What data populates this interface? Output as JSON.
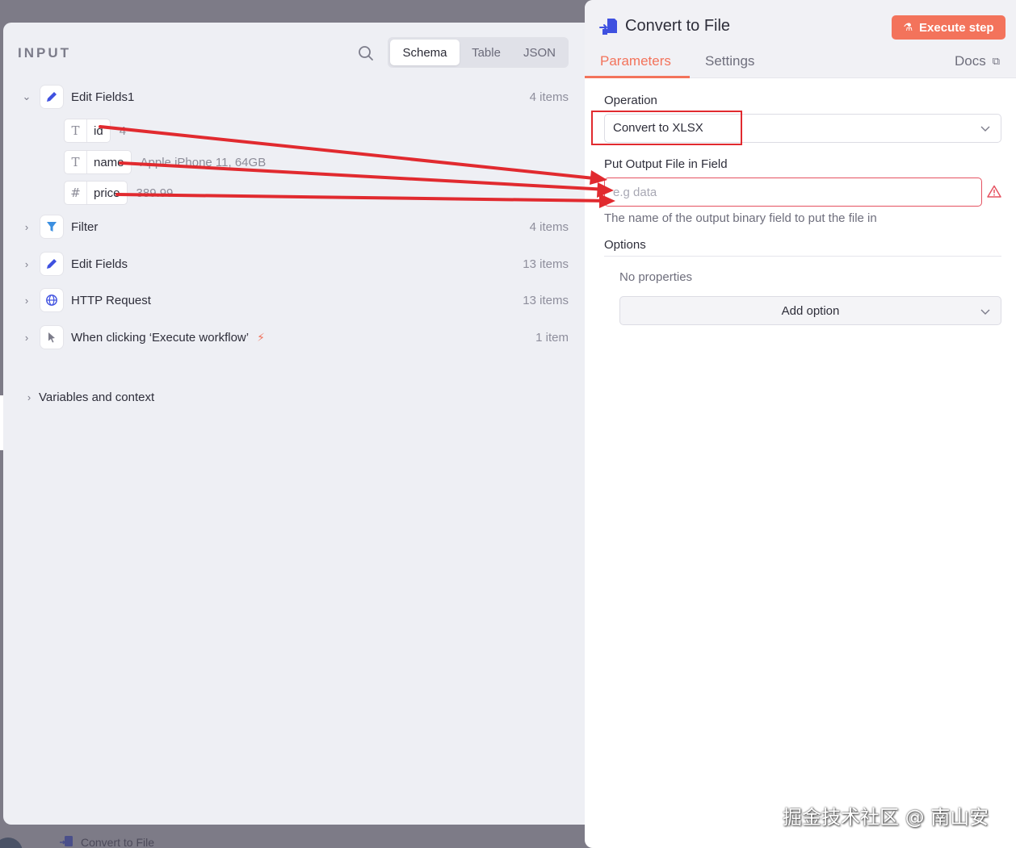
{
  "background_node": {
    "label": "Convert to File"
  },
  "input_panel": {
    "title": "INPUT",
    "view_tabs": [
      "Schema",
      "Table",
      "JSON"
    ],
    "active_view": "Schema",
    "nodes": [
      {
        "label": "Edit Fields1",
        "count": "4 items",
        "expanded": true,
        "icon": "pencil-icon"
      },
      {
        "label": "Filter",
        "count": "4 items",
        "expanded": false,
        "icon": "funnel-icon"
      },
      {
        "label": "Edit Fields",
        "count": "13 items",
        "expanded": false,
        "icon": "pencil-icon"
      },
      {
        "label": "HTTP Request",
        "count": "13 items",
        "expanded": false,
        "icon": "globe-icon"
      },
      {
        "label": "When clicking ‘Execute workflow’",
        "count": "1 item",
        "expanded": false,
        "icon": "cursor-icon"
      }
    ],
    "fields": [
      {
        "type_symbol": "T",
        "name": "id",
        "value": "4"
      },
      {
        "type_symbol": "T",
        "name": "name",
        "value": "Apple iPhone 11, 64GB"
      },
      {
        "type_symbol": "#",
        "name": "price",
        "value": "389.99"
      }
    ],
    "variables_label": "Variables and context"
  },
  "node_panel": {
    "title": "Convert to File",
    "execute_label": "Execute step",
    "tabs": [
      "Parameters",
      "Settings"
    ],
    "active_tab": "Parameters",
    "docs_label": "Docs",
    "operation_label": "Operation",
    "operation_value": "Convert to XLSX",
    "output_field_label": "Put Output File in Field",
    "output_field_placeholder": "e.g data",
    "output_field_hint": "The name of the output binary field to put the file in",
    "options_label": "Options",
    "no_properties": "No properties",
    "add_option_label": "Add option"
  },
  "watermark": "掘金技术社区 @ 南山安",
  "colors": {
    "accent": "#f3735b",
    "annotation_red": "#e12a2f",
    "node_icon_blue": "#3f51e0",
    "error_red": "#e55261"
  }
}
